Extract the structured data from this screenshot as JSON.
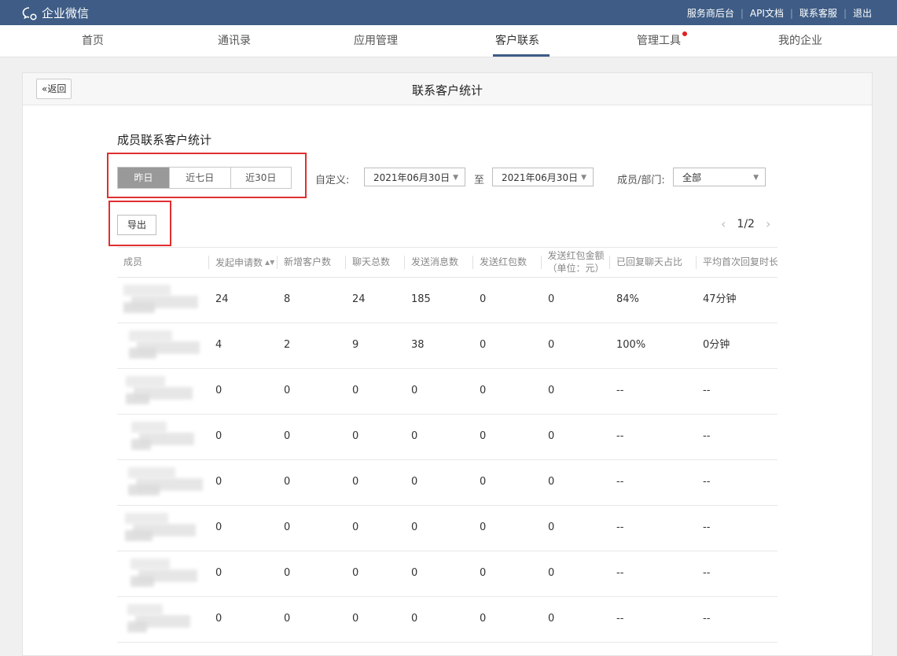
{
  "app": {
    "name": "企业微信"
  },
  "top_links": [
    "服务商后台",
    "API文档",
    "联系客服",
    "退出"
  ],
  "nav": [
    {
      "label": "首页",
      "active": false
    },
    {
      "label": "通讯录",
      "active": false
    },
    {
      "label": "应用管理",
      "active": false
    },
    {
      "label": "客户联系",
      "active": true
    },
    {
      "label": "管理工具",
      "active": false,
      "badge": true
    },
    {
      "label": "我的企业",
      "active": false
    }
  ],
  "panel": {
    "back_label": "返回",
    "title": "联系客户统计",
    "section_title": "成员联系客户统计"
  },
  "filters": {
    "ranges": [
      {
        "label": "昨日",
        "selected": true
      },
      {
        "label": "近七日",
        "selected": false
      },
      {
        "label": "近30日",
        "selected": false
      }
    ],
    "custom_label": "自定义:",
    "start_date": "2021年06月30日",
    "to_label": "至",
    "end_date": "2021年06月30日",
    "member_label": "成员/部门:",
    "member_value": "全部"
  },
  "export_label": "导出",
  "pager": {
    "text": "1/2"
  },
  "table": {
    "columns": [
      "成员",
      "发起申请数",
      "新增客户数",
      "聊天总数",
      "发送消息数",
      "发送红包数",
      "发送红包金额\n（单位：元）",
      "已回复聊天占比",
      "平均首次回复时长"
    ],
    "rows": [
      [
        "24",
        "8",
        "24",
        "185",
        "0",
        "0",
        "84%",
        "47分钟"
      ],
      [
        "4",
        "2",
        "9",
        "38",
        "0",
        "0",
        "100%",
        "0分钟"
      ],
      [
        "0",
        "0",
        "0",
        "0",
        "0",
        "0",
        "--",
        "--"
      ],
      [
        "0",
        "0",
        "0",
        "0",
        "0",
        "0",
        "--",
        "--"
      ],
      [
        "0",
        "0",
        "0",
        "0",
        "0",
        "0",
        "--",
        "--"
      ],
      [
        "0",
        "0",
        "0",
        "0",
        "0",
        "0",
        "--",
        "--"
      ],
      [
        "0",
        "0",
        "0",
        "0",
        "0",
        "0",
        "--",
        "--"
      ],
      [
        "0",
        "0",
        "0",
        "0",
        "0",
        "0",
        "--",
        "--"
      ]
    ]
  },
  "colors": {
    "topbar": "#3e5c85",
    "highlight_box": "#e02f2f",
    "badge": "#e02020"
  }
}
